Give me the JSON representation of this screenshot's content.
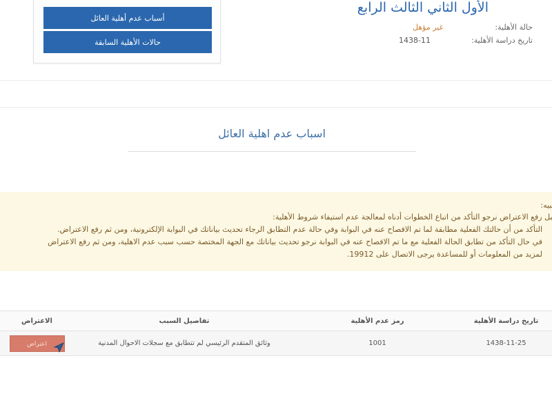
{
  "header": {
    "stage_title": "الأول الثاني الثالث الرابع",
    "status_label": "حالة الأهلية:",
    "status_value": "غير مؤهل",
    "date_label": "تاريخ دراسة الأهلية:",
    "date_value": "1438-11"
  },
  "nav": {
    "reasons_button": "أسباب عدم أهلية العائل",
    "history_button": "حالات الأهلية السابقة"
  },
  "section": {
    "title": "اسباب عدم اهلية العائل"
  },
  "warning": {
    "heading": "تنبيه:",
    "intro": "قبل رفع الاعتراض نرجو التأكد من اتباع الخطوات أدناه لمعالجة عدم استيفاء شروط الأهلية:",
    "items": [
      "التأكد من أن حالتك الفعلية مطابقة لما تم الافصاح عنه في البوابة وفي حالة عدم التطابق الرجاء تحديث بياناتك في البوابة الإلكترونية، ومن ثم رفع الاعتراض.",
      "في حال التأكد من تطابق الحالة الفعلية مع ما تم الافصاح عنه في البوابة نرجو تحديث بياناتك مع الجهة المختصة حسب سبب عدم الاهلية، ومن ثم رفع الاعتراض",
      "لمزيد من المعلومات أو للمساعدة يرجى الاتصال على 19912."
    ]
  },
  "table": {
    "headers": [
      "تاريخ دراسة الأهلية",
      "رمز عدم الأهلية",
      "تفاصيل السبب",
      "الاعتراض"
    ],
    "rows": [
      {
        "date": "1438-11-25",
        "code": "1001",
        "details": "وثائق المتقدم الرئيسي لم تتطابق مع سجلات الاحوال المدنية",
        "objection_label": "اعتراض"
      }
    ]
  },
  "colors": {
    "primary": "#2a67ae",
    "status": "#c8813a",
    "warning_bg": "#fcf8e3",
    "objection_button": "#d77b6a"
  },
  "icons": {
    "cursor": "mouse-pointer-icon"
  }
}
